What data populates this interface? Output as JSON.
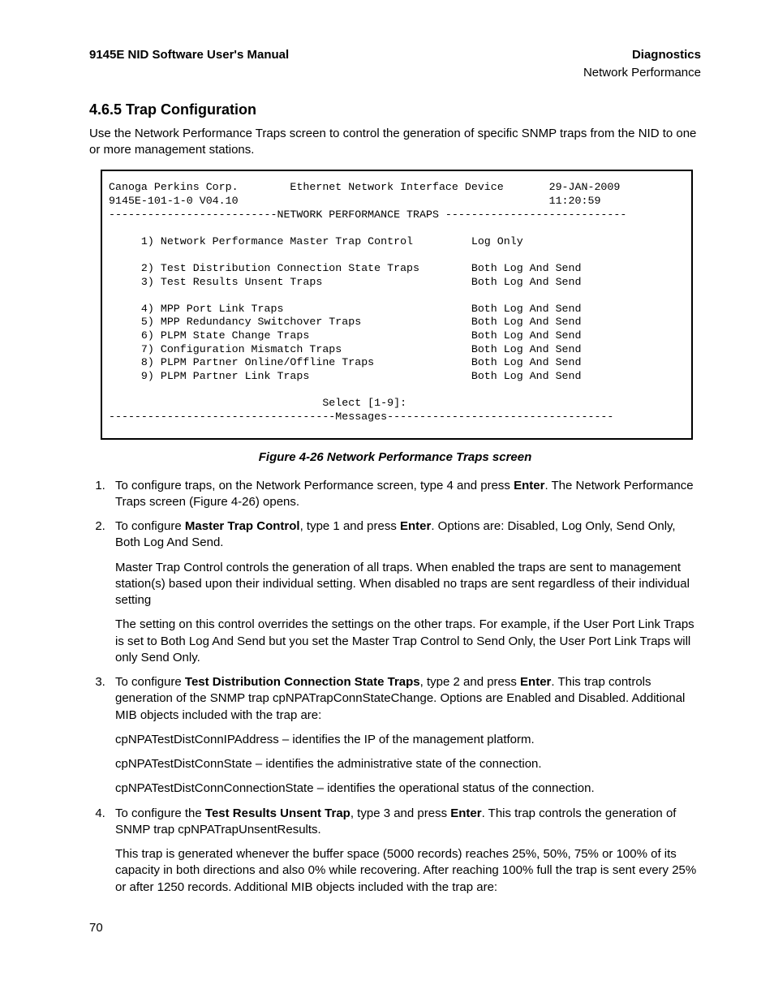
{
  "header": {
    "left": "9145E NID Software User's Manual",
    "right_bold": "Diagnostics",
    "right_sub": "Network Performance"
  },
  "section": {
    "number_title": "4.6.5  Trap Configuration",
    "intro": "Use the Network Performance Traps screen to control the generation of specific SNMP traps from the NID to one or more management stations."
  },
  "terminal": {
    "corp": "Canoga Perkins Corp.",
    "device": "Ethernet Network Interface Device",
    "date": "29-JAN-2009",
    "model": "9145E-101-1-0 V04.10",
    "time": "11:20:59",
    "title_bar": "--------------------------NETWORK PERFORMANCE TRAPS ----------------------------",
    "items": [
      {
        "n": "1",
        "label": "Network Performance Master Trap Control",
        "value": "Log Only"
      },
      {
        "n": "2",
        "label": "Test Distribution Connection State Traps",
        "value": "Both Log And Send"
      },
      {
        "n": "3",
        "label": "Test Results Unsent Traps",
        "value": "Both Log And Send"
      },
      {
        "n": "4",
        "label": "MPP Port Link Traps",
        "value": "Both Log And Send"
      },
      {
        "n": "5",
        "label": "MPP Redundancy Switchover Traps",
        "value": "Both Log And Send"
      },
      {
        "n": "6",
        "label": "PLPM State Change Traps",
        "value": "Both Log And Send"
      },
      {
        "n": "7",
        "label": "Configuration Mismatch Traps",
        "value": "Both Log And Send"
      },
      {
        "n": "8",
        "label": "PLPM Partner Online/Offline Traps",
        "value": "Both Log And Send"
      },
      {
        "n": "9",
        "label": "PLPM Partner Link Traps",
        "value": "Both Log And Send"
      }
    ],
    "prompt": "Select [1-9]:",
    "messages_bar": "-----------------------------------Messages-----------------------------------"
  },
  "figure_caption": "Figure 4-26  Network Performance Traps screen",
  "steps": {
    "s1a": "To configure traps, on the Network Performance screen, type 4 and press ",
    "s1b": ". The Network Performance Traps screen (Figure 4-26) opens.",
    "s2a": "To configure ",
    "s2bold": "Master Trap Control",
    "s2b": ", type 1 and press ",
    "s2c": ". Options are: Disabled, Log Only, Send Only, Both Log And Send.",
    "s2p1": "Master Trap Control controls the generation of all traps. When enabled the traps are sent to management station(s) based upon their individual setting. When disabled no traps are sent regardless of their individual setting",
    "s2p2": "The setting on this control overrides the settings on the other traps. For example, if the User Port Link Traps is set to Both Log And Send but you set the Master Trap Control to Send Only, the User Port Link Traps will only Send Only.",
    "s3a": "To configure ",
    "s3bold": "Test Distribution Connection State Traps",
    "s3b": ", type 2 and press ",
    "s3c": ". This trap controls generation of the SNMP trap cpNPATrapConnStateChange. Options are Enabled and Disabled. Additional MIB objects included with the trap are:",
    "s3p1": "cpNPATestDistConnIPAddress – identifies the IP of the management platform.",
    "s3p2": "cpNPATestDistConnState – identifies the administrative state of the connection.",
    "s3p3": "cpNPATestDistConnConnectionState – identifies the operational status of the connection.",
    "s4a": "To configure the ",
    "s4bold": "Test Results Unsent Trap",
    "s4b": ", type 3 and press ",
    "s4c": ". This trap controls the generation of SNMP trap cpNPATrapUnsentResults.",
    "s4p1": "This trap is generated whenever the buffer space (5000 records) reaches 25%, 50%, 75% or 100% of its capacity in both directions and also 0% while recovering. After reaching 100% full the trap is sent every 25% or after 1250 records. Additional MIB objects included with the trap are:",
    "enter": "Enter"
  },
  "page_number": "70"
}
